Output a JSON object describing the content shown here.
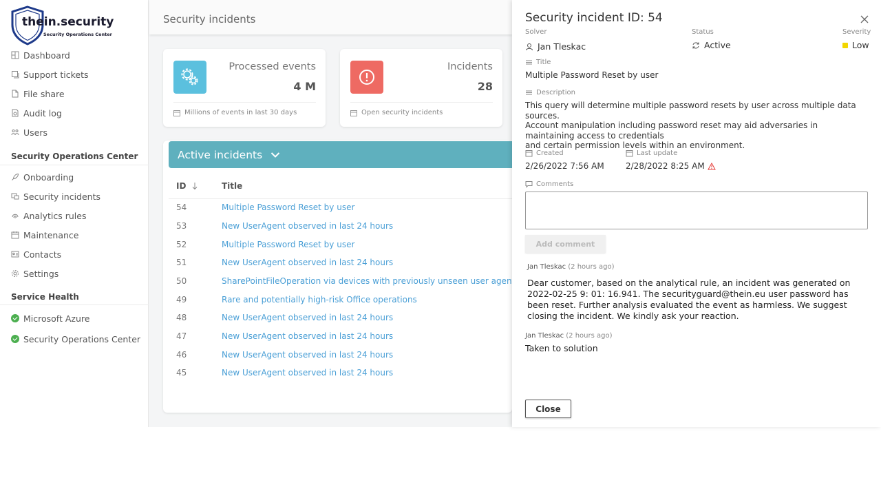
{
  "brand": {
    "name": "thein.security",
    "tagline": "Security Operations Center"
  },
  "sidebar": {
    "main_items": [
      {
        "label": "Dashboard",
        "icon": "dashboard-icon"
      },
      {
        "label": "Support tickets",
        "icon": "ticket-icon"
      },
      {
        "label": "File share",
        "icon": "file-icon"
      },
      {
        "label": "Audit log",
        "icon": "audit-icon"
      },
      {
        "label": "Users",
        "icon": "users-icon"
      }
    ],
    "soc_title": "Security Operations Center",
    "soc_items": [
      {
        "label": "Onboarding",
        "icon": "rocket-icon"
      },
      {
        "label": "Security incidents",
        "icon": "incident-icon"
      },
      {
        "label": "Analytics rules",
        "icon": "fingerprint-icon"
      },
      {
        "label": "Maintenance",
        "icon": "calendar-icon"
      },
      {
        "label": "Contacts",
        "icon": "contact-card-icon"
      },
      {
        "label": "Settings",
        "icon": "gear-icon"
      }
    ],
    "health_title": "Service Health",
    "health_items": [
      {
        "label": "Microsoft Azure",
        "status_color": "#4caf50"
      },
      {
        "label": "Security Operations Center",
        "status_color": "#4caf50"
      }
    ]
  },
  "header": {
    "title": "Security incidents"
  },
  "cards": {
    "processed": {
      "label": "Processed events",
      "value": "4 M",
      "footer": "Millions of events in last 30 days",
      "color": "#5bc0de"
    },
    "incidents": {
      "label": "Incidents",
      "value": "28",
      "footer": "Open security incidents",
      "color": "#ee6a63"
    }
  },
  "list": {
    "title": "Active incidents",
    "columns": {
      "id": "ID",
      "title": "Title"
    },
    "rows": [
      {
        "id": "54",
        "title": "Multiple Password Reset by user"
      },
      {
        "id": "53",
        "title": "New UserAgent observed in last 24 hours"
      },
      {
        "id": "52",
        "title": "Multiple Password Reset by user"
      },
      {
        "id": "51",
        "title": "New UserAgent observed in last 24 hours"
      },
      {
        "id": "50",
        "title": "SharePointFileOperation via devices with previously unseen user agents"
      },
      {
        "id": "49",
        "title": "Rare and potentially high-risk Office operations"
      },
      {
        "id": "48",
        "title": "New UserAgent observed in last 24 hours"
      },
      {
        "id": "47",
        "title": "New UserAgent observed in last 24 hours"
      },
      {
        "id": "46",
        "title": "New UserAgent observed in last 24 hours"
      },
      {
        "id": "45",
        "title": "New UserAgent observed in last 24 hours"
      }
    ]
  },
  "drawer": {
    "title": "Security incident ID: 54",
    "solver_label": "Solver",
    "solver": "Jan Tleskac",
    "status_label": "Status",
    "status": "Active",
    "severity_label": "Severity",
    "severity": "Low",
    "severity_color": "#f2d600",
    "title_label": "Title",
    "incident_title": "Multiple Password Reset by user",
    "description_label": "Description",
    "description_lines": [
      "This query will determine multiple password resets by user across multiple data sources.",
      "Account manipulation including password reset may aid adversaries in maintaining access to credentials",
      "and certain permission levels within an environment."
    ],
    "created_label": "Created",
    "created": "2/26/2022 7:56 AM",
    "updated_label": "Last update",
    "updated": "2/28/2022 8:25 AM",
    "comments_label": "Comments",
    "comment_value": "",
    "add_comment_label": "Add comment",
    "comments": [
      {
        "author": "Jan Tleskac",
        "ago": "(2 hours ago)",
        "text": "Dear customer, based on the analytical rule, an incident was generated on 2022-02-25 9: 01: 16.941. The securityguard@thein.eu user password has been reset. Further analysis evaluated the event as harmless. We suggest closing the incident. We kindly ask your reaction."
      },
      {
        "author": "Jan Tleskac",
        "ago": "(2 hours ago)",
        "text": "Taken to solution"
      }
    ],
    "close_label": "Close"
  }
}
